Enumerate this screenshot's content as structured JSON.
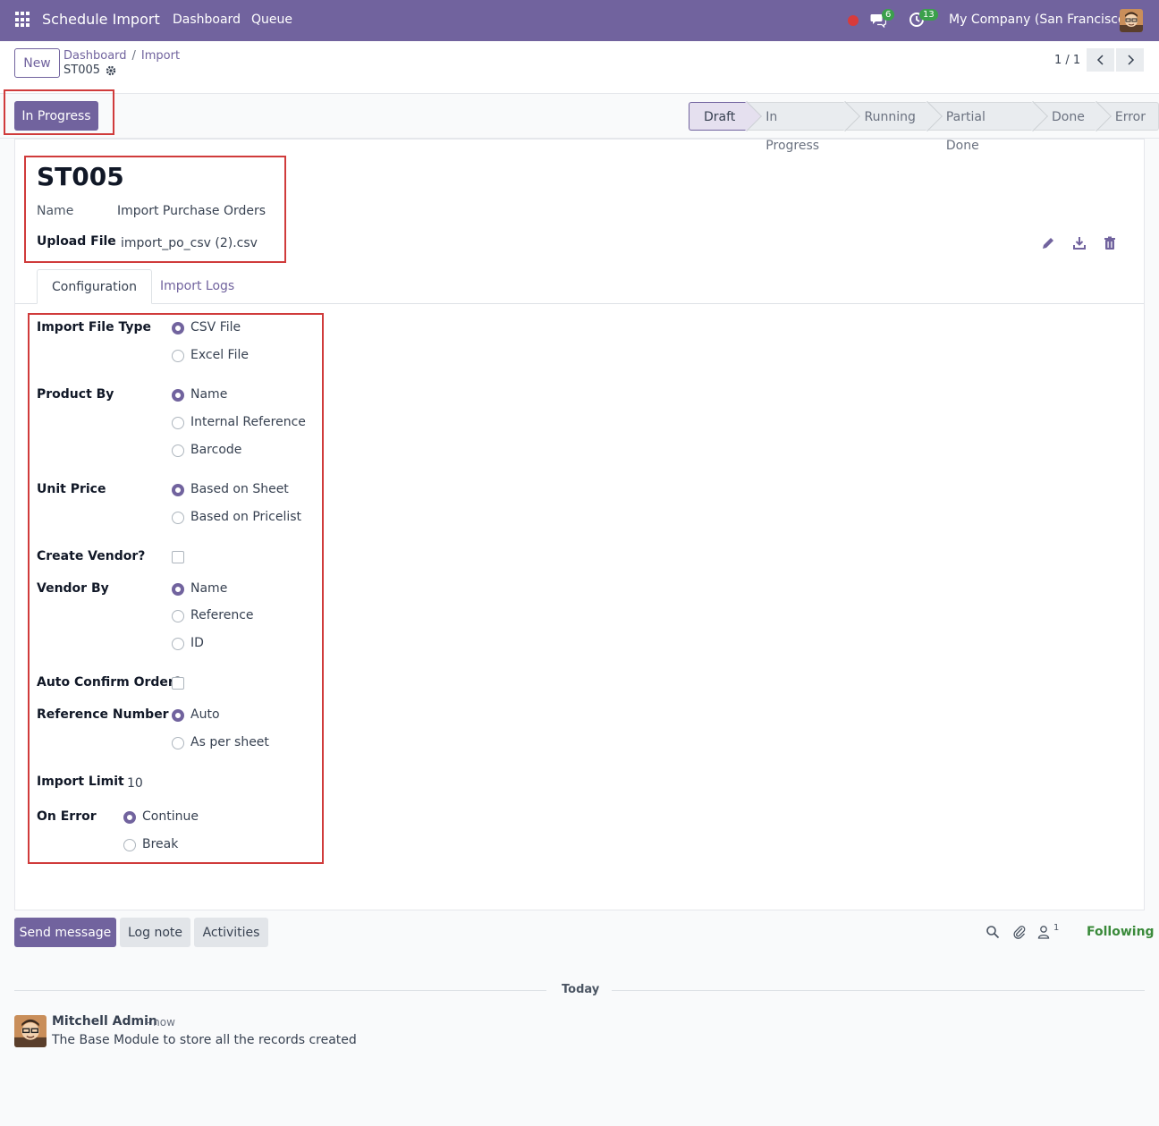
{
  "navbar": {
    "app_title": "Schedule Import",
    "menu": [
      "Dashboard",
      "Queue"
    ],
    "messages_badge": "6",
    "activities_badge": "13",
    "company": "My Company (San Francisco)"
  },
  "control_panel": {
    "new_label": "New",
    "breadcrumb": [
      "Dashboard",
      "Import"
    ],
    "record_title": "ST005",
    "pager": "1 / 1"
  },
  "statusbar": {
    "action_label": "In Progress",
    "stages": [
      "Draft",
      "In Progress",
      "Running",
      "Partial Done",
      "Done",
      "Error"
    ],
    "active_stage": "Draft"
  },
  "form": {
    "record_name": "ST005",
    "name_label": "Name",
    "name_value": "Import Purchase Orders",
    "upload_label": "Upload File",
    "upload_value": "import_po_csv (2).csv",
    "tabs": [
      "Configuration",
      "Import Logs"
    ],
    "fields": {
      "file_type": {
        "label": "Import File Type",
        "options": [
          "CSV File",
          "Excel File"
        ],
        "selected": "CSV File"
      },
      "product_by": {
        "label": "Product By",
        "options": [
          "Name",
          "Internal Reference",
          "Barcode"
        ],
        "selected": "Name"
      },
      "unit_price": {
        "label": "Unit Price",
        "options": [
          "Based on Sheet",
          "Based on Pricelist"
        ],
        "selected": "Based on Sheet"
      },
      "create_vendor": {
        "label": "Create Vendor?",
        "checked": false
      },
      "vendor_by": {
        "label": "Vendor By",
        "options": [
          "Name",
          "Reference",
          "ID"
        ],
        "selected": "Name"
      },
      "auto_confirm": {
        "label": "Auto Confirm Order?",
        "checked": false
      },
      "reference_number": {
        "label": "Reference Number",
        "options": [
          "Auto",
          "As per sheet"
        ],
        "selected": "Auto"
      },
      "import_limit": {
        "label": "Import Limit",
        "value": "10"
      },
      "on_error": {
        "label": "On Error",
        "options": [
          "Continue",
          "Break"
        ],
        "selected": "Continue"
      }
    }
  },
  "chatter": {
    "send_label": "Send message",
    "log_label": "Log note",
    "activities_label": "Activities",
    "followers_count": "1",
    "following_label": "Following",
    "today_label": "Today",
    "message": {
      "author": "Mitchell Admin",
      "time": "- now",
      "body": "The Base Module to store all the records created"
    }
  },
  "colors": {
    "brand": "#71639e",
    "highlight": "#d03b3b",
    "following": "#3a8a3a"
  }
}
